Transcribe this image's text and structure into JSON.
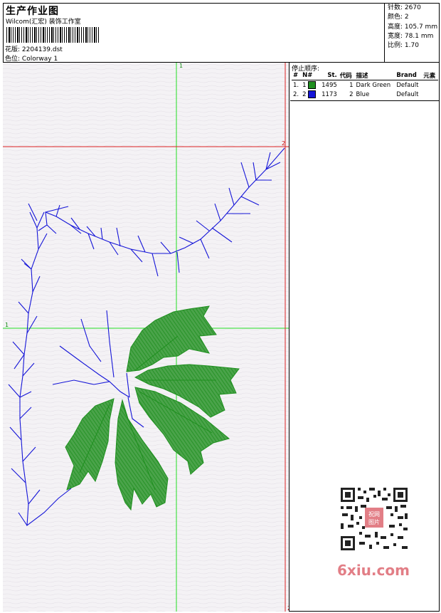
{
  "header": {
    "title": "生产作业图",
    "subtitle": "Wilcom(汇宏) 装饰工作室",
    "design_label": "花版:",
    "design_value": "2204139.dst",
    "colorway_label": "色位:",
    "colorway_value": "Colorway 1"
  },
  "stats": {
    "stitches_label": "针数:",
    "stitches_value": "2670",
    "colors_label": "颜色:",
    "colors_value": "2",
    "height_label": "高度:",
    "height_value": "105.7 mm",
    "width_label": "宽度:",
    "width_value": "78.1 mm",
    "scale_label": "比例:",
    "scale_value": "1.70"
  },
  "stop_sequence": {
    "title": "停止顺序:",
    "columns": [
      "#",
      "N#",
      "St.",
      "代码",
      "描述",
      "Brand",
      "元素"
    ],
    "rows": [
      {
        "index": "1.",
        "n": "1",
        "color": "#1f8f1f",
        "stitches": "1495",
        "code": "1",
        "description": "Dark Green",
        "brand": "Default"
      },
      {
        "index": "2.",
        "n": "2",
        "color": "#1515d8",
        "stitches": "1173",
        "code": "2",
        "description": "Blue",
        "brand": "Default"
      }
    ]
  },
  "canvas": {
    "marker_1": "1",
    "marker_2": "2",
    "marker_top": "1",
    "marker_bottom": "2",
    "guide_green": "#22dd22",
    "guide_red": "#dd2222",
    "thread_blue": "#1515d8",
    "thread_green": "#1f8f1f"
  },
  "watermark": {
    "text": "6xiu.com",
    "badge_line1": "祝网",
    "badge_line2": "图片",
    "color": "#e27e86"
  }
}
